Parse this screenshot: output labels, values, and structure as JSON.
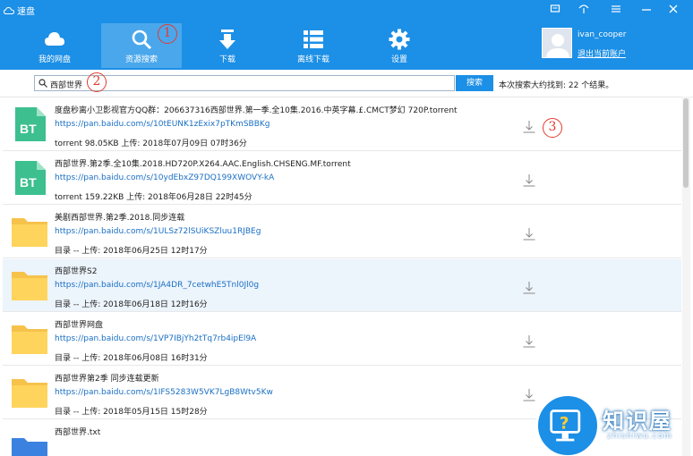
{
  "app": {
    "title": "速盘",
    "accent": "#1c8fe6",
    "cloud_icon": "cloud-icon"
  },
  "window_controls": [
    "menu-icon",
    "skin-icon",
    "settings-lines-icon",
    "minimize-icon",
    "close-icon"
  ],
  "nav": [
    {
      "label": "我的网盘",
      "icon": "cloud-icon"
    },
    {
      "label": "资源搜索",
      "icon": "search-icon"
    },
    {
      "label": "下载",
      "icon": "download-icon"
    },
    {
      "label": "离线下载",
      "icon": "grid-list-icon"
    },
    {
      "label": "设置",
      "icon": "gear-icon"
    }
  ],
  "user": {
    "name": "ivan_cooper",
    "logout": "退出当前账户"
  },
  "search": {
    "query": "西部世界",
    "button": "搜索",
    "result_info": "本次搜索大约找到: 22 个结果。"
  },
  "markers": {
    "one": "1",
    "two": "2",
    "three": "3"
  },
  "results": [
    {
      "type": "BT",
      "name": "度盘秒离小卫影视官方QQ群：206637316西部世界.第一季.全10集.2016.中英字幕.£.CMCT梦幻 720P.torrent",
      "link": "https://pan.baidu.com/s/10tEUNK1zExix7pTKmSBBKg",
      "meta": "torrent 98.05KB 上传: 2018年07月09日 07时36分"
    },
    {
      "type": "BT",
      "name": "西部世界.第2季.全10集.2018.HD720P.X264.AAC.English.CHSENG.MF.torrent",
      "link": "https://pan.baidu.com/s/10ydEbxZ97DQ199XWOVY-kA",
      "meta": "torrent 159.22KB 上传: 2018年06月28日 22时45分"
    },
    {
      "type": "folder",
      "name": "美剧西部世界.第2季.2018.同步连载",
      "link": "https://pan.baidu.com/s/1ULSz72lSUiKSZluu1RJBEg",
      "meta": "目录 -- 上传: 2018年06月25日 12时17分"
    },
    {
      "type": "folder",
      "name": "西部世界S2",
      "link": "https://pan.baidu.com/s/1JA4DR_7cetwhE5Tnl0Jl0g",
      "meta": "目录 -- 上传: 2018年06月18日 12时16分"
    },
    {
      "type": "folder",
      "name": "西部世界网盘",
      "link": "https://pan.baidu.com/s/1VP7IBjYh2tTq7rb4ipEl9A",
      "meta": "目录 -- 上传: 2018年06月08日 16时31分"
    },
    {
      "type": "folder",
      "name": "西部世界第2季 同步连载更新",
      "link": "https://pan.baidu.com/s/1IFS5283W5VK7LgB8Wtv5Kw",
      "meta": "目录 -- 上传: 2018年05月15日 15时28分"
    },
    {
      "type": "file",
      "name": "西部世界.txt",
      "link": "",
      "meta": ""
    }
  ],
  "watermark": {
    "brand": "知识屋",
    "domain": "zhishiwu.com"
  }
}
